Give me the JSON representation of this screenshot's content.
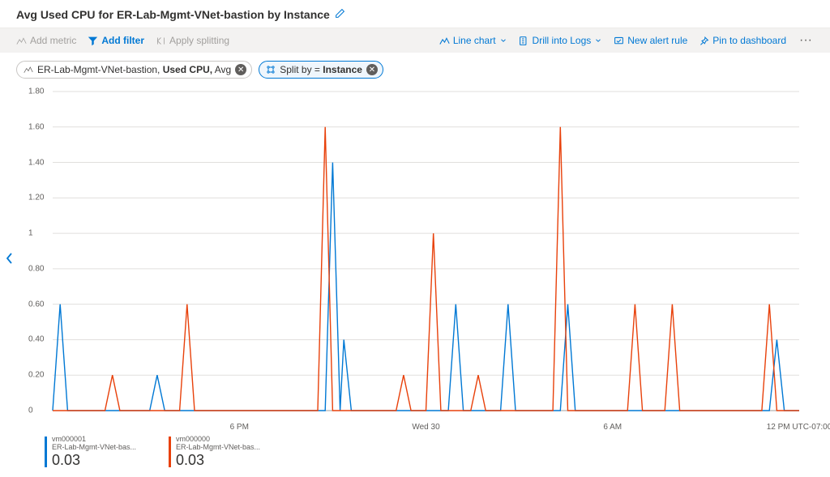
{
  "header": {
    "title": "Avg Used CPU for ER-Lab-Mgmt-VNet-bastion by Instance"
  },
  "toolbar": {
    "add_metric": "Add metric",
    "add_filter": "Add filter",
    "apply_splitting": "Apply splitting",
    "line_chart": "Line chart",
    "drill_logs": "Drill into Logs",
    "new_alert": "New alert rule",
    "pin_dash": "Pin to dashboard"
  },
  "pills": {
    "metric_resource": "ER-Lab-Mgmt-VNet-bastion, ",
    "metric_name": "Used CPU,",
    "metric_agg": " Avg",
    "split_prefix": "Split by = ",
    "split_val": "Instance"
  },
  "legend": {
    "s1_name": "vm000001",
    "s1_sub": "ER-Lab-Mgmt-VNet-bas...",
    "s1_val": "0.03",
    "s2_name": "vm000000",
    "s2_sub": "ER-Lab-Mgmt-VNet-bas...",
    "s2_val": "0.03"
  },
  "chart_data": {
    "type": "line",
    "ylim": [
      0,
      1.8
    ],
    "yticks": [
      0,
      0.2,
      0.4,
      0.6,
      0.8,
      1.0,
      1.2,
      1.4,
      1.6,
      1.8
    ],
    "ytick_labels": [
      "0",
      "0.20",
      "0.40",
      "0.60",
      "0.80",
      "1",
      "1.20",
      "1.40",
      "1.60",
      "1.80"
    ],
    "xlim": [
      0,
      100
    ],
    "xticks": [
      25,
      50,
      75,
      100
    ],
    "xtick_labels": [
      "6 PM",
      "Wed 30",
      "6 AM",
      "12 PM  UTC-07:00"
    ],
    "colors": {
      "vm000001": "#0078d4",
      "vm000000": "#e8410b"
    },
    "series": [
      {
        "name": "vm000001",
        "points": [
          [
            0,
            0
          ],
          [
            1,
            0.6
          ],
          [
            2,
            0
          ],
          [
            13,
            0
          ],
          [
            14,
            0.2
          ],
          [
            15,
            0
          ],
          [
            36.5,
            0
          ],
          [
            37.5,
            1.4
          ],
          [
            38.5,
            0
          ],
          [
            39,
            0.4
          ],
          [
            40,
            0
          ],
          [
            53,
            0
          ],
          [
            54,
            0.6
          ],
          [
            55,
            0
          ],
          [
            60,
            0
          ],
          [
            61,
            0.6
          ],
          [
            62,
            0
          ],
          [
            68,
            0
          ],
          [
            69,
            0.6
          ],
          [
            70,
            0
          ],
          [
            96,
            0
          ],
          [
            97,
            0.4
          ],
          [
            98,
            0
          ],
          [
            100,
            0
          ]
        ]
      },
      {
        "name": "vm000000",
        "points": [
          [
            0,
            0
          ],
          [
            7,
            0
          ],
          [
            8,
            0.2
          ],
          [
            9,
            0
          ],
          [
            17,
            0
          ],
          [
            18,
            0.6
          ],
          [
            19,
            0
          ],
          [
            35.5,
            0
          ],
          [
            36.5,
            1.6
          ],
          [
            37.5,
            0
          ],
          [
            46,
            0
          ],
          [
            47,
            0.2
          ],
          [
            48,
            0
          ],
          [
            50,
            0
          ],
          [
            51,
            1.0
          ],
          [
            52,
            0
          ],
          [
            56,
            0
          ],
          [
            57,
            0.2
          ],
          [
            58,
            0
          ],
          [
            67,
            0
          ],
          [
            68,
            1.6
          ],
          [
            69,
            0
          ],
          [
            77,
            0
          ],
          [
            78,
            0.6
          ],
          [
            79,
            0
          ],
          [
            82,
            0
          ],
          [
            83,
            0.6
          ],
          [
            84,
            0
          ],
          [
            95,
            0
          ],
          [
            96,
            0.6
          ],
          [
            97,
            0
          ],
          [
            100,
            0
          ]
        ]
      }
    ]
  }
}
